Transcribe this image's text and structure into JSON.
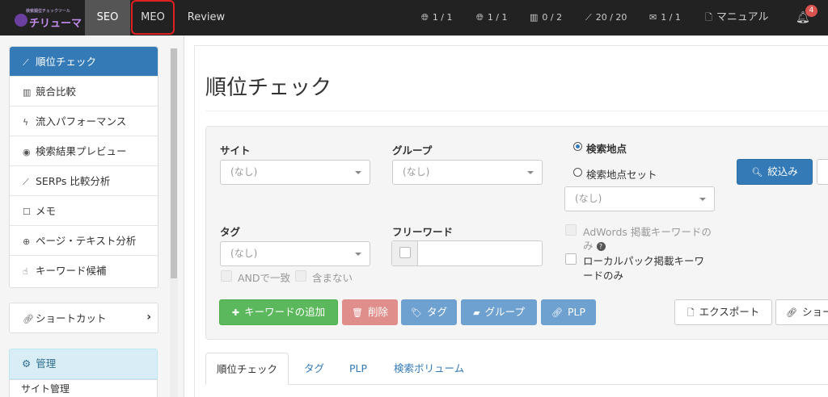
{
  "nav": {
    "logo_sub": "検索順位チェックツール",
    "logo_main": "チリューマ",
    "tabs": [
      "SEO",
      "MEO",
      "Review"
    ],
    "stats": [
      {
        "icon": "globe-icon",
        "value": "1 / 1"
      },
      {
        "icon": "globe-icon",
        "value": "1 / 1"
      },
      {
        "icon": "bar-chart-icon",
        "value": "0 / 2"
      },
      {
        "icon": "line-chart-icon",
        "value": "20 / 20"
      },
      {
        "icon": "comments-icon",
        "value": "1 / 1"
      },
      {
        "icon": "document-icon",
        "value": "マニュアル"
      }
    ],
    "notification_count": "4"
  },
  "sidebar": {
    "items": [
      {
        "label": "順位チェック",
        "icon": "line-chart-icon"
      },
      {
        "label": "競合比較",
        "icon": "bar-chart-icon"
      },
      {
        "label": "流入パフォーマンス",
        "icon": "bolt-icon"
      },
      {
        "label": "検索結果プレビュー",
        "icon": "eye-icon"
      },
      {
        "label": "SERPs 比較分析",
        "icon": "line-chart-icon"
      },
      {
        "label": "メモ",
        "icon": "note-icon"
      },
      {
        "label": "ページ・テキスト分析",
        "icon": "search-plus-icon"
      },
      {
        "label": "キーワード候補",
        "icon": "thumbs-up-icon"
      }
    ],
    "shortcut": "ショートカット",
    "manage_header": "管理",
    "manage_items": [
      "サイト管理"
    ]
  },
  "main": {
    "title": "順位チェック",
    "filters": {
      "site_label": "サイト",
      "site_value": "(なし)",
      "group_label": "グループ",
      "group_value": "(なし)",
      "location_radio": "検索地点",
      "location_set_radio": "検索地点セット",
      "location_value": "(なし)",
      "tag_label": "タグ",
      "tag_value": "(なし)",
      "and_match": "ANDで一致",
      "exclude": "含まない",
      "freeword_label": "フリーワード",
      "freeword_value": "",
      "adwords_line1": "AdWords 掲載キーワードの",
      "adwords_line2": "み",
      "localpack_line1": "ローカルパック掲載キーワ",
      "localpack_line2": "ードのみ"
    },
    "buttons": {
      "filter": "絞込み",
      "add_keyword": "キーワードの追加",
      "delete": "削除",
      "tag": "タグ",
      "group": "グループ",
      "plp": "PLP",
      "export": "エクスポート",
      "shortcut": "ショー"
    },
    "tabs": [
      "順位チェック",
      "タグ",
      "PLP",
      "検索ボリューム"
    ]
  }
}
